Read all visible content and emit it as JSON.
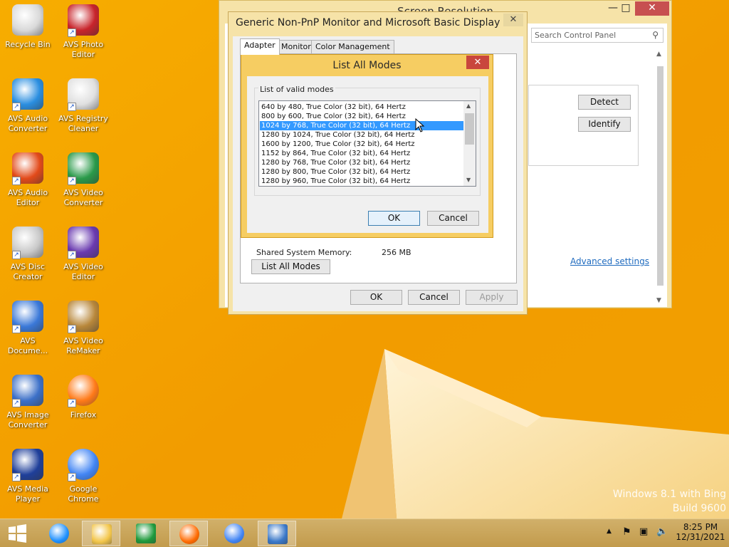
{
  "desktop": {
    "icons": [
      {
        "label": "Recycle Bin",
        "icon": "recycle-bin-icon"
      },
      {
        "label": "AVS Photo Editor",
        "icon": "avs-photo-editor-icon"
      },
      {
        "label": "AVS Audio Converter",
        "icon": "avs-audio-converter-icon"
      },
      {
        "label": "AVS Registry Cleaner",
        "icon": "avs-registry-cleaner-icon"
      },
      {
        "label": "AVS Audio Editor",
        "icon": "avs-audio-editor-icon"
      },
      {
        "label": "AVS Video Converter",
        "icon": "avs-video-converter-icon"
      },
      {
        "label": "AVS Disc Creator",
        "icon": "avs-disc-creator-icon"
      },
      {
        "label": "AVS Video Editor",
        "icon": "avs-video-editor-icon"
      },
      {
        "label": "AVS Docume...",
        "icon": "avs-document-converter-icon"
      },
      {
        "label": "AVS Video ReMaker",
        "icon": "avs-video-remaker-icon"
      },
      {
        "label": "AVS Image Converter",
        "icon": "avs-image-converter-icon"
      },
      {
        "label": "Firefox",
        "icon": "firefox-icon"
      },
      {
        "label": "AVS Media Player",
        "icon": "avs-media-player-icon"
      },
      {
        "label": "Google Chrome",
        "icon": "google-chrome-icon"
      }
    ],
    "watermark_line1": "Windows 8.1 with Bing",
    "watermark_line2": "Build 9600"
  },
  "screen_resolution_window": {
    "title": "Screen Resolution",
    "minimize_glyph": "—",
    "maximize_glyph": "□",
    "close_glyph": "✕",
    "search_placeholder": "Search Control Panel",
    "detect_label": "Detect",
    "identify_label": "Identify",
    "advanced_settings_link": "Advanced settings"
  },
  "monitor_dialog": {
    "title": "Generic Non-PnP Monitor and Microsoft Basic Display ...",
    "close_glyph": "✕",
    "tabs": [
      {
        "label": "Adapter",
        "active": true
      },
      {
        "label": "Monitor",
        "active": false
      },
      {
        "label": "Color Management",
        "active": false
      }
    ],
    "shared_memory_label": "Shared System Memory:",
    "shared_memory_value": "256 MB",
    "list_all_modes_button": "List All Modes",
    "ok_label": "OK",
    "cancel_label": "Cancel",
    "apply_label": "Apply"
  },
  "list_all_modes_dialog": {
    "title": "List All Modes",
    "close_glyph": "✕",
    "group_label": "List of valid modes",
    "modes": [
      "640 by 480, True Color (32 bit), 64 Hertz",
      "800 by 600, True Color (32 bit), 64 Hertz",
      "1024 by 768, True Color (32 bit), 64 Hertz",
      "1280 by 1024, True Color (32 bit), 64 Hertz",
      "1600 by 1200, True Color (32 bit), 64 Hertz",
      "1152 by 864, True Color (32 bit), 64 Hertz",
      "1280 by 768, True Color (32 bit), 64 Hertz",
      "1280 by 800, True Color (32 bit), 64 Hertz",
      "1280 by 960, True Color (32 bit), 64 Hertz"
    ],
    "selected_mode_index": 2,
    "ok_label": "OK",
    "cancel_label": "Cancel"
  },
  "taskbar": {
    "start_icon": "windows-start-icon",
    "pinned": [
      {
        "icon": "internet-explorer-icon",
        "open": false
      },
      {
        "icon": "file-explorer-icon",
        "open": true
      },
      {
        "icon": "store-icon",
        "open": false
      },
      {
        "icon": "firefox-icon",
        "open": true
      },
      {
        "icon": "google-chrome-icon",
        "open": false
      },
      {
        "icon": "control-panel-icon",
        "open": true
      }
    ],
    "clock_time": "8:25 PM",
    "clock_date": "12/31/2021"
  },
  "colors": {
    "wallpaper": "#f5a800",
    "dialog_frame": "#f6cd62",
    "selection": "#3399ff",
    "taskbar": "#c8a55a"
  }
}
